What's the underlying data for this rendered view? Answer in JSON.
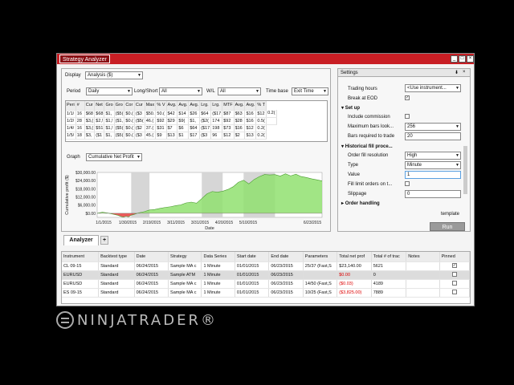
{
  "window": {
    "title": "Strategy Analyzer"
  },
  "left": {
    "display_label": "Display",
    "display_value": "Analysis ($)",
    "filters": [
      {
        "label": "Period",
        "value": "Daily"
      },
      {
        "label": "Long/Short",
        "value": "All"
      },
      {
        "label": "W/L",
        "value": "All"
      },
      {
        "label": "Time base",
        "value": "Exit Time"
      }
    ],
    "summary_headers": [
      "Peri",
      "#",
      "Cur",
      "Net",
      "Gro",
      "Gro",
      "Cor",
      "Cur",
      "Max",
      "% V",
      "Avg.",
      "Avg.",
      "Avg.",
      "Lrg.",
      "Lrg.",
      "MTF",
      "Avg.",
      "Avg.",
      "% T"
    ],
    "summary_rows": [
      [
        "1/1/",
        "16",
        "$68",
        "$68",
        "$1,",
        "($5(",
        "$0.(",
        "($3",
        "$50.",
        "50.(",
        "$42",
        "$14",
        "$26",
        "$64",
        "($17",
        "$87",
        "$63",
        "$16",
        "$12",
        "0.2("
      ],
      [
        "1/2/",
        "28",
        "$3,(",
        "$2,!",
        "$1,!",
        "($1,",
        "$0.(",
        "($5(",
        "46.(",
        "$92",
        "$29",
        "$9(",
        "$1,",
        "($2(",
        "174",
        "$92",
        "$28",
        "$16",
        "0.5(",
        ""
      ],
      [
        "1/4/",
        "16",
        "$3,(",
        "$51",
        "$1,!",
        "($5(",
        "$0.(",
        "($2",
        "37.(",
        "$31",
        "$7",
        "$6",
        "$64",
        "($17",
        "198",
        "$73",
        "$16",
        "$12",
        "0.2("
      ],
      [
        "1/5/",
        "18",
        "$3,",
        "($1",
        "$1,",
        "($5(",
        "$0.(",
        "($3",
        "45.(",
        "$9",
        "$13",
        "$1",
        "$17",
        "($3",
        "96",
        "$12",
        "$2",
        "$13",
        "0.2("
      ]
    ],
    "graph_label": "Graph",
    "graph_value": "Cumulative Net Profit"
  },
  "chart_data": {
    "type": "area",
    "title": "",
    "xlabel": "Date",
    "ylabel": "Cumulative profit ($)",
    "x_ticks": [
      "1/1/2015",
      "1/30/2015",
      "2/19/2015",
      "3/11/2015",
      "3/31/2015",
      "4/20/2015",
      "5/10/2015",
      "6/23/2015"
    ],
    "y_ticks": [
      "$0.00",
      "$6,000.00",
      "$12,000.00",
      "$18,000.00",
      "$24,000.00",
      "$30,000.00"
    ],
    "ylim": [
      -3000,
      30000
    ],
    "x": [
      0,
      4,
      8,
      12,
      16,
      18,
      20,
      22,
      24,
      26,
      28,
      32,
      36,
      40,
      44,
      48,
      52,
      56,
      60,
      64,
      68,
      72,
      76,
      80,
      84,
      88,
      92,
      96,
      100,
      104,
      108,
      112,
      116,
      120,
      124,
      128,
      132,
      136,
      140,
      144,
      148,
      152,
      156,
      160,
      164,
      168,
      172
    ],
    "values": [
      0,
      800,
      200,
      -600,
      -1500,
      -2300,
      -2800,
      -2200,
      -2600,
      -1400,
      -900,
      400,
      1200,
      2400,
      2800,
      3600,
      4300,
      4800,
      5600,
      6200,
      7600,
      8200,
      7400,
      10800,
      14300,
      16000,
      15500,
      16200,
      17500,
      19500,
      22800,
      24300,
      21600,
      24800,
      26900,
      28500,
      28200,
      28400,
      27300,
      29000,
      27500,
      28700,
      27000,
      26300,
      25300,
      24600,
      23800
    ],
    "shaded_bands": [
      [
        26,
        40
      ],
      [
        80,
        96
      ],
      [
        112,
        136
      ]
    ],
    "colors": {
      "positive": "#90e070",
      "negative": "#e84040",
      "band": "#d6d6d6"
    }
  },
  "tabs": {
    "analyzer": "Analyzer",
    "add": "+"
  },
  "right": {
    "title": "Settings",
    "items": [
      {
        "label": "Trading hours",
        "value": "<Use instrument..."
      },
      {
        "label": "Break at EOD",
        "checked": true
      }
    ],
    "section_setup": "Set up",
    "setup_items": [
      {
        "label": "Include commission",
        "checked": false
      },
      {
        "label": "Maximum bars look...",
        "value": "256"
      },
      {
        "label": "Bars required to trade",
        "value": "20"
      }
    ],
    "section_hist": "Historical fill proce...",
    "hist_items": [
      {
        "label": "Order fill resolution",
        "value": "High"
      },
      {
        "label": "Type",
        "value": "Minute"
      },
      {
        "label": "Value",
        "value": "1"
      },
      {
        "label": "Fill limit orders on t...",
        "checked": false
      },
      {
        "label": "Slippage",
        "value": "0"
      }
    ],
    "section_order": "Order handling",
    "template_label": "template",
    "run_label": "Run"
  },
  "results": {
    "headers": [
      "Instrument",
      "Backtest type",
      "Date",
      "Strategy",
      "Data Series",
      "Start date",
      "End date",
      "Parameters",
      "Total net prof",
      "Total # of trac",
      "Notes",
      "Pinned"
    ],
    "rows": [
      {
        "cells": [
          "CL 09-15",
          "Standard",
          "06/24/2015",
          "Sample MA c",
          "1 Minute",
          "01/01/2015",
          "06/23/2015",
          "25/37 (Fast,S",
          "$23,140.00",
          "5621",
          "",
          ""
        ],
        "neg": false,
        "pinned": true,
        "selected": false
      },
      {
        "cells": [
          "EURUSD",
          "Standard",
          "06/24/2015",
          "Sample ATM",
          "1 Minute",
          "01/01/2015",
          "06/23/2015",
          "",
          "$0.00",
          "0",
          "",
          ""
        ],
        "neg": true,
        "pinned": false,
        "selected": true
      },
      {
        "cells": [
          "EURUSD",
          "Standard",
          "06/24/2015",
          "Sample MA c",
          "1 Minute",
          "01/01/2015",
          "06/23/2015",
          "14/50 (Fast,S",
          "($0.03)",
          "4189",
          "",
          ""
        ],
        "neg": true,
        "pinned": false,
        "selected": false
      },
      {
        "cells": [
          "ES 09-15",
          "Standard",
          "06/24/2015",
          "Sample MA c",
          "1 Minute",
          "01/01/2015",
          "06/23/2015",
          "10/25 (Fast,S",
          "($3,825.00)",
          "7889",
          "",
          ""
        ],
        "neg": true,
        "pinned": false,
        "selected": false
      }
    ]
  },
  "logo": {
    "text": "NINJATRADER®"
  }
}
